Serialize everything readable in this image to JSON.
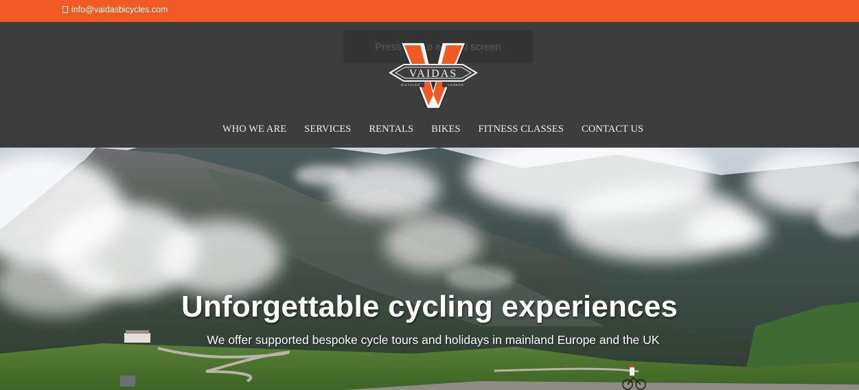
{
  "topbar": {
    "email": "info@vaidasbicycles.com",
    "icon": "envelope-icon",
    "color": "#f15a22"
  },
  "header": {
    "fullscreen_hint": "Press F11 to exit full screen",
    "logo": {
      "name": "VAIDAS",
      "left_word": "BICYCLES",
      "right_word": "LONDON",
      "accent": "#f15a22"
    }
  },
  "nav": {
    "items": [
      {
        "label": "WHO WE ARE"
      },
      {
        "label": "SERVICES"
      },
      {
        "label": "RENTALS"
      },
      {
        "label": "BIKES"
      },
      {
        "label": "FITNESS CLASSES"
      },
      {
        "label": "CONTACT US"
      }
    ]
  },
  "hero": {
    "title": "Unforgettable cycling experiences",
    "subtitle": "We offer supported bespoke cycle tours and holidays in mainland Europe and the UK"
  },
  "colors": {
    "header_bg": "#3d3d3d",
    "nav_text": "#ececec"
  }
}
